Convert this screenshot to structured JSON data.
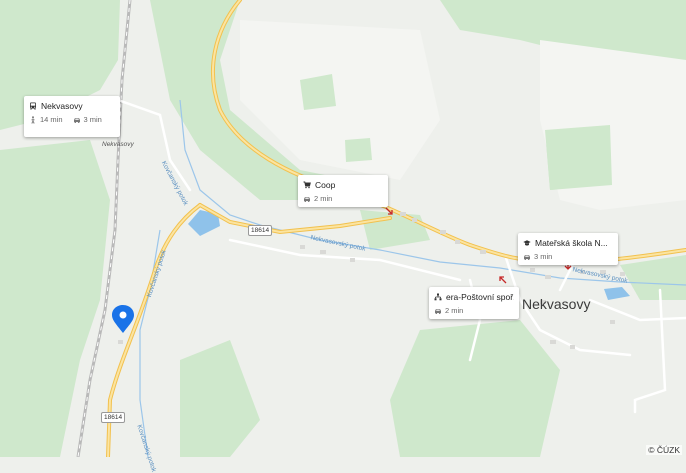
{
  "map": {
    "colors": {
      "background": "#eef0ec",
      "forest": "#cfe8cc",
      "road_main": "#f6cd6a",
      "road_minor": "#ffffff",
      "water": "#8fc2ea",
      "rail": "#b8b8b8"
    }
  },
  "labels": {
    "village": "Nekvasovy",
    "bus_stop": "Nekvasovy",
    "road_number": "18614",
    "stream_1": "Nekvasovský potok",
    "stream_2": "Kovčanský potok",
    "stream_3": "Kovčanský potok",
    "stream_4": "Kovčanský potok"
  },
  "cards": {
    "transit": {
      "title": "Nekvasovy",
      "walk_time": "14 min",
      "drive_time": "3 min",
      "icon": "bus-icon"
    },
    "coop": {
      "title": "Coop",
      "drive_time": "2 min",
      "icon": "cart-icon"
    },
    "school": {
      "title": "Mateřská škola N...",
      "drive_time": "3 min",
      "icon": "graduation-cap-icon"
    },
    "bank": {
      "title": "era-Poštovní spoř...",
      "drive_time": "2 min",
      "icon": "bank-icon"
    }
  },
  "copyright": "© ČÚZK"
}
